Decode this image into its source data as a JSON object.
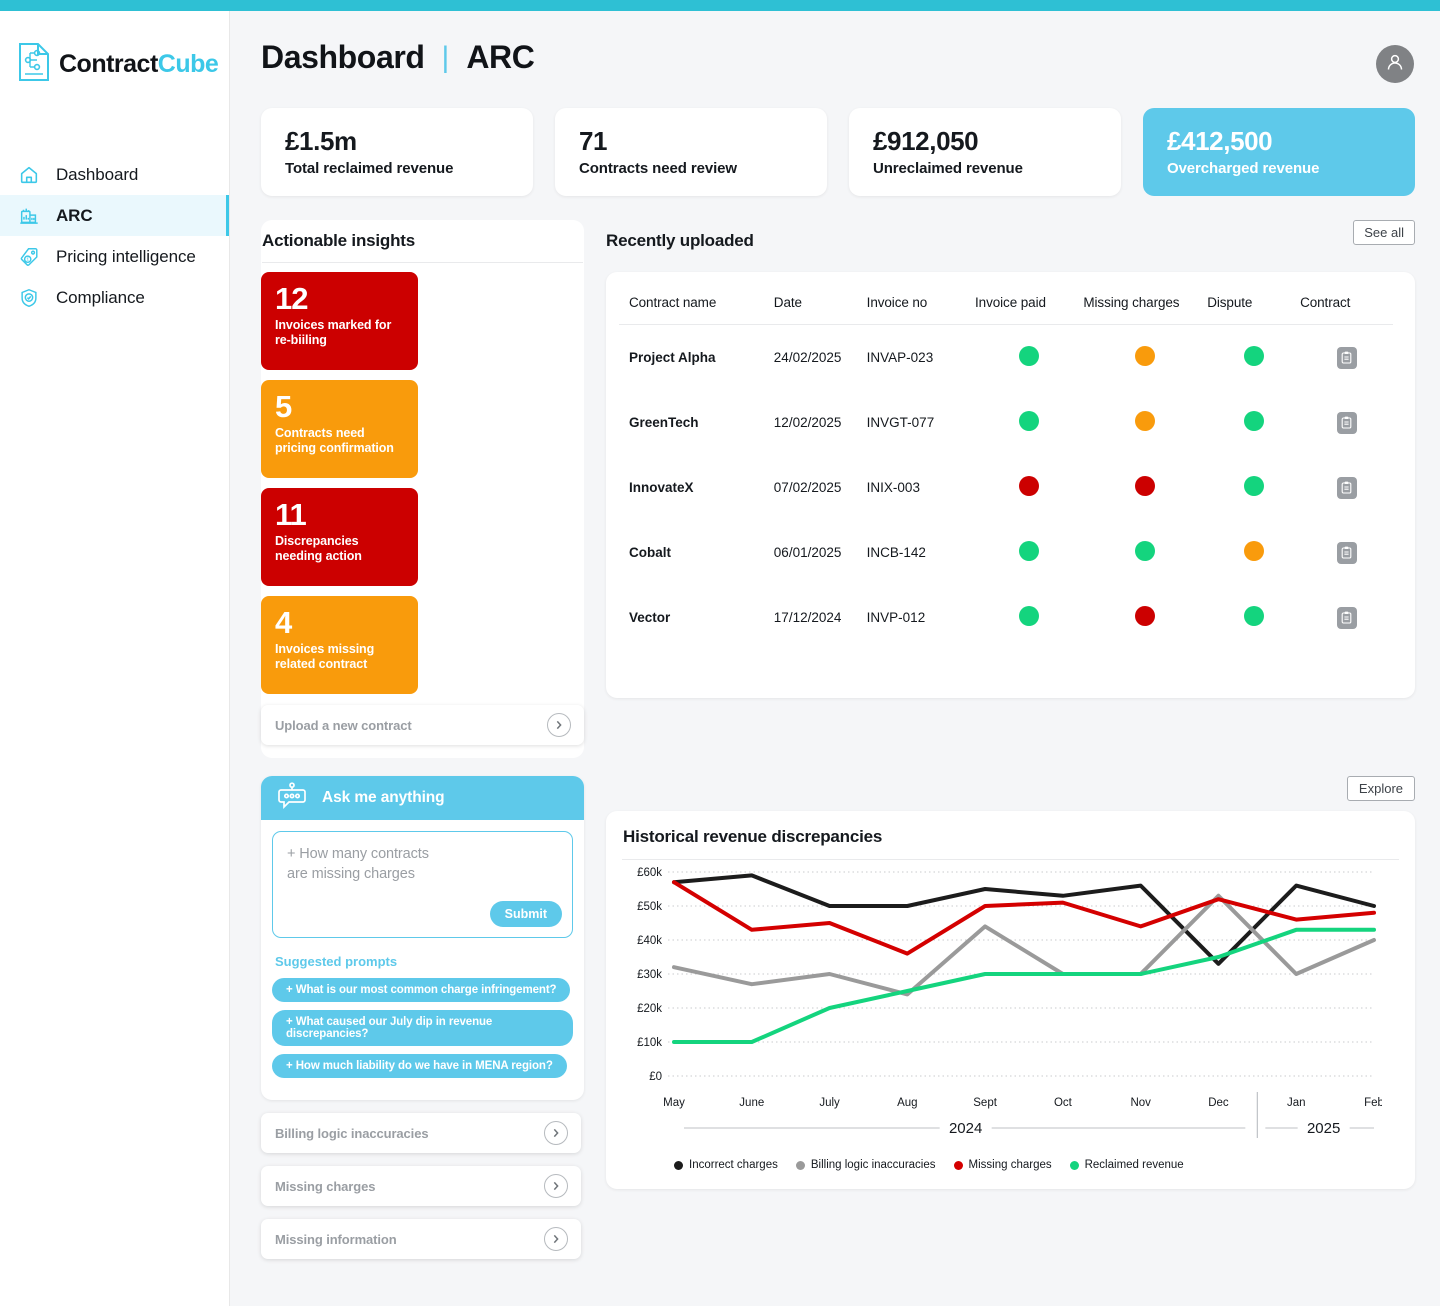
{
  "brand": {
    "name_part1": "Contract",
    "name_part2": "Cube",
    "accent": "#3cc8e8",
    "topbar_color": "#2ec0d4"
  },
  "sidebar": {
    "items": [
      {
        "label": "Dashboard",
        "icon": "home-icon",
        "active": false
      },
      {
        "label": "ARC",
        "icon": "chart-building-icon",
        "active": true
      },
      {
        "label": "Pricing intelligence",
        "icon": "price-tag-icon",
        "active": false
      },
      {
        "label": "Compliance",
        "icon": "shield-check-icon",
        "active": false
      }
    ]
  },
  "header": {
    "title": "Dashboard",
    "separator": "|",
    "subtitle": "ARC",
    "avatar_icon": "user-avatar-icon"
  },
  "kpis": [
    {
      "value": "£1.5m",
      "label": "Total reclaimed revenue",
      "accent": false
    },
    {
      "value": "71",
      "label": "Contracts need review",
      "accent": false
    },
    {
      "value": "£912,050",
      "label": "Unreclaimed  revenue",
      "accent": false
    },
    {
      "value": "£412,500",
      "label": "Overcharged revenue",
      "accent": true
    }
  ],
  "insights": {
    "title": "Actionable insights",
    "tiles": [
      {
        "number": "12",
        "label": "Invoices marked for re-biiling",
        "color": "red"
      },
      {
        "number": "5",
        "label": "Contracts need pricing confirmation",
        "color": "orange"
      },
      {
        "number": "11",
        "label": "Discrepancies needing action",
        "color": "red"
      },
      {
        "number": "4",
        "label": "Invoices missing related contract",
        "color": "orange"
      }
    ],
    "upload_label": "Upload a new contract"
  },
  "recently_uploaded": {
    "title": "Recently uploaded",
    "see_all_label": "See all",
    "columns": [
      "Contract name",
      "Date",
      "Invoice no",
      "Invoice paid",
      "Missing charges",
      "Dispute",
      "Contract"
    ],
    "rows": [
      {
        "name": "Project Alpha",
        "date": "24/02/2025",
        "invoice_no": "INVAP-023",
        "invoice_paid": "green",
        "missing_charges": "orange",
        "dispute": "green",
        "contract_icon": "document-icon"
      },
      {
        "name": "GreenTech",
        "date": "12/02/2025",
        "invoice_no": "INVGT-077",
        "invoice_paid": "green",
        "missing_charges": "orange",
        "dispute": "green",
        "contract_icon": "document-icon"
      },
      {
        "name": "InnovateX",
        "date": "07/02/2025",
        "invoice_no": "INIX-003",
        "invoice_paid": "red",
        "missing_charges": "red",
        "dispute": "green",
        "contract_icon": "document-icon"
      },
      {
        "name": "Cobalt",
        "date": "06/01/2025",
        "invoice_no": "INCB-142",
        "invoice_paid": "green",
        "missing_charges": "green",
        "dispute": "orange",
        "contract_icon": "document-icon"
      },
      {
        "name": "Vector",
        "date": "17/12/2024",
        "invoice_no": "INVP-012",
        "invoice_paid": "green",
        "missing_charges": "red",
        "dispute": "green",
        "contract_icon": "document-icon"
      }
    ],
    "status_colors": {
      "green": "#14d47e",
      "orange": "#f99b0c",
      "red": "#cc0000"
    }
  },
  "assistant": {
    "title": "Ask me anything",
    "icon": "robot-icon",
    "input_value": "+ How many contracts\n   are missing charges",
    "submit_label": "Submit",
    "suggested_title": "Suggested prompts",
    "prompts": [
      "+ What is our most common charge infringement?",
      "+ What caused our July dip in revenue discrepancies?",
      "+ How much liability do we have in MENA region?"
    ],
    "list_rows": [
      "Billing logic inaccuracies",
      "Missing charges",
      "Missing information"
    ]
  },
  "chart_panel": {
    "explore_label": "Explore"
  },
  "chart_data": {
    "type": "line",
    "title": "Historical revenue discrepancies",
    "xlabel": "",
    "ylabel": "",
    "categories": [
      "May",
      "June",
      "July",
      "Aug",
      "Sept",
      "Oct",
      "Nov",
      "Dec",
      "Jan",
      "Feb"
    ],
    "year_groups": [
      {
        "label": "2024",
        "months": [
          "May",
          "June",
          "July",
          "Aug",
          "Sept",
          "Oct",
          "Nov",
          "Dec"
        ]
      },
      {
        "label": "2025",
        "months": [
          "Jan",
          "Feb"
        ]
      }
    ],
    "ylim": [
      0,
      60000
    ],
    "ytick_labels": [
      "£0",
      "£10k",
      "£20k",
      "£30k",
      "£40k",
      "£50k",
      "£60k"
    ],
    "yticks": [
      0,
      10000,
      20000,
      30000,
      40000,
      50000,
      60000
    ],
    "grid": true,
    "legend_position": "bottom",
    "series": [
      {
        "name": "Incorrect charges",
        "color": "#1c1c1c",
        "values": [
          57000,
          59000,
          50000,
          50000,
          55000,
          53000,
          56000,
          33000,
          56000,
          50000
        ]
      },
      {
        "name": "Billing logic inaccuracies",
        "color": "#9a9a9a",
        "values": [
          32000,
          27000,
          30000,
          24000,
          44000,
          30000,
          30000,
          53000,
          30000,
          40000
        ]
      },
      {
        "name": "Missing charges",
        "color": "#d40000",
        "values": [
          57000,
          43000,
          45000,
          36000,
          50000,
          51000,
          44000,
          52000,
          46000,
          48000
        ]
      },
      {
        "name": "Reclaimed revenue",
        "color": "#14d47e",
        "values": [
          10000,
          10000,
          20000,
          25000,
          30000,
          30000,
          30000,
          35000,
          43000,
          43000
        ]
      }
    ]
  }
}
